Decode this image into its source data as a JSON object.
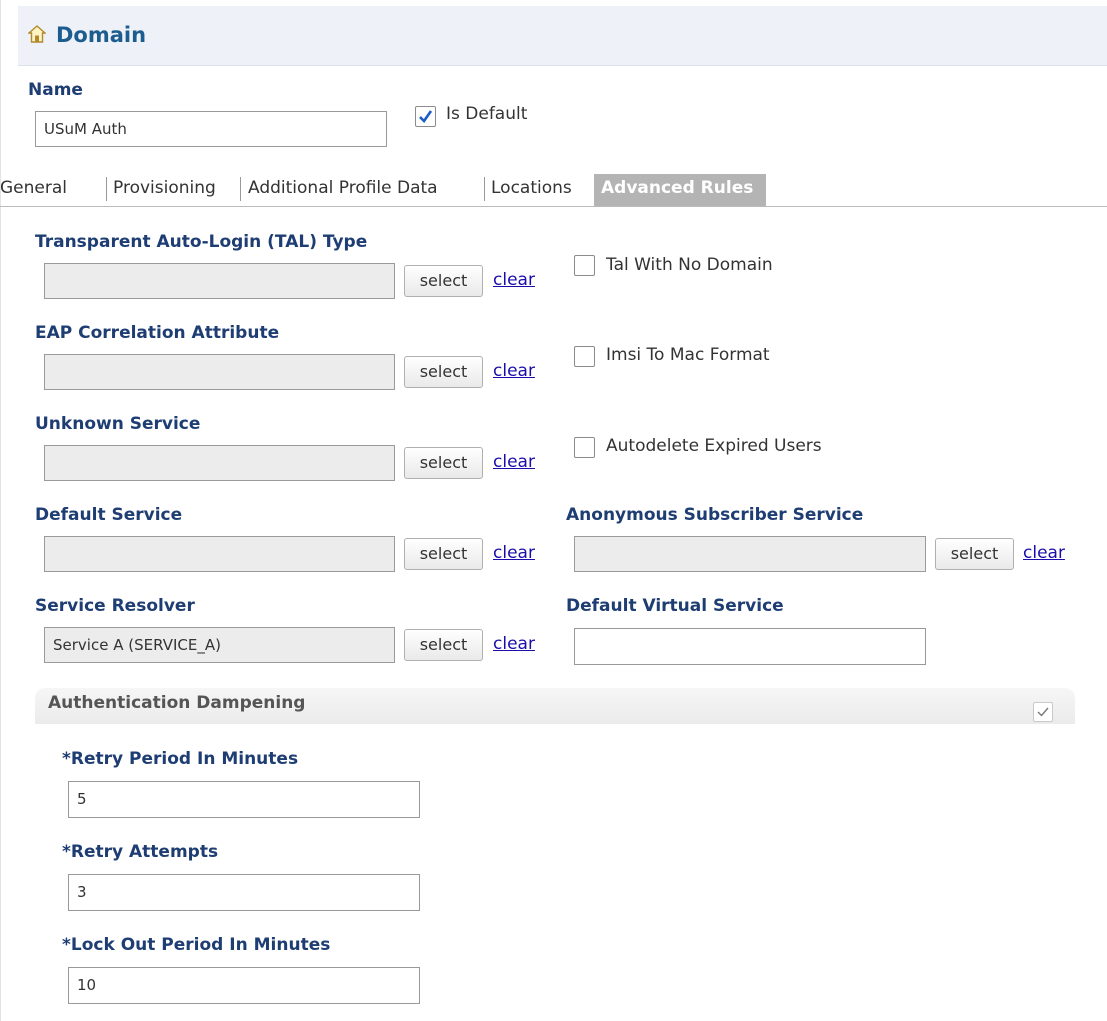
{
  "header": {
    "title": "Domain",
    "icon": "home-icon"
  },
  "name_label": "Name",
  "name_value": "USuM Auth",
  "is_default": {
    "label": "Is Default",
    "checked": true
  },
  "tabs": [
    "General",
    "Provisioning",
    "Additional Profile Data",
    "Locations",
    "Advanced Rules"
  ],
  "active_tab": "Advanced Rules",
  "fields": {
    "tal_type": {
      "label": "Transparent Auto-Login (TAL) Type",
      "value": ""
    },
    "eap": {
      "label": "EAP Correlation Attribute",
      "value": ""
    },
    "unknown_service": {
      "label": "Unknown Service",
      "value": ""
    },
    "default_service": {
      "label": "Default Service",
      "value": ""
    },
    "anonymous_service": {
      "label": "Anonymous Subscriber Service",
      "value": ""
    },
    "service_resolver": {
      "label": "Service Resolver",
      "value": "Service A (SERVICE_A)"
    },
    "default_virtual": {
      "label": "Default Virtual Service",
      "value": ""
    }
  },
  "checkboxes": {
    "tal_no_domain": {
      "label": "Tal With No Domain",
      "checked": false
    },
    "imsi_mac": {
      "label": "Imsi To Mac Format",
      "checked": false
    },
    "autodelete": {
      "label": "Autodelete Expired Users",
      "checked": false
    }
  },
  "buttons": {
    "select": "select",
    "clear": "clear"
  },
  "dampening": {
    "title": "Authentication Dampening",
    "enabled": true,
    "retry_period": {
      "label": "*Retry Period In Minutes",
      "value": "5"
    },
    "retry_attempts": {
      "label": "*Retry Attempts",
      "value": "3"
    },
    "lockout": {
      "label": "*Lock Out Period In Minutes",
      "value": "10"
    }
  },
  "colors": {
    "label": "#1e3d73",
    "header_title": "#1d5c8f",
    "active_tab": "#b4b4b4",
    "link": "#1a0dab"
  }
}
